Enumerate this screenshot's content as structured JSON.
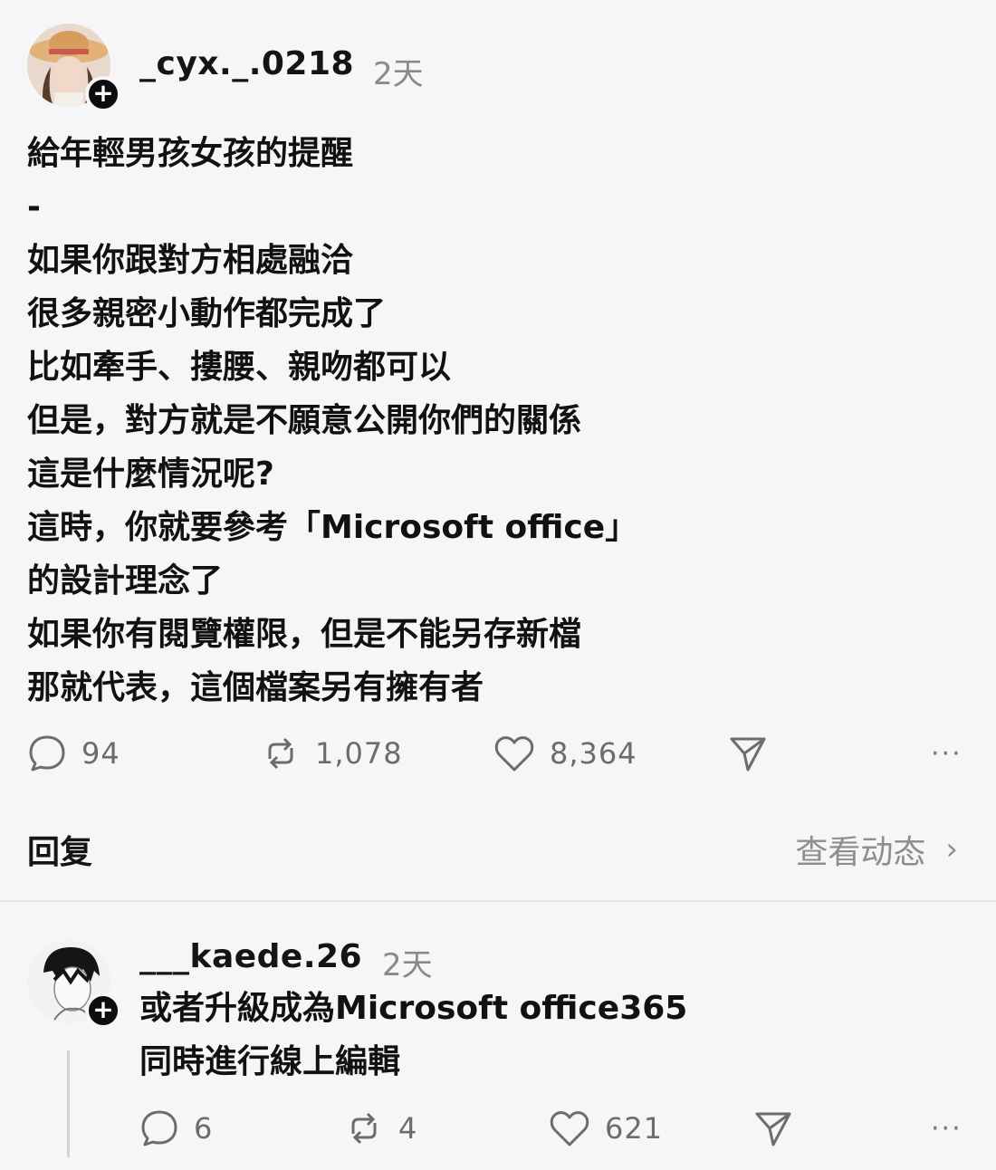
{
  "post": {
    "username": "_cyx._.0218",
    "time": "2天",
    "lines": [
      "給年輕男孩女孩的提醒",
      "-",
      "如果你跟對方相處融洽",
      "很多親密小動作都完成了",
      "比如牽手、摟腰、親吻都可以",
      "但是，對方就是不願意公開你們的關係",
      "這是什麼情況呢?",
      "這時，你就要參考「Microsoft office」",
      "的設計理念了",
      "如果你有閱覽權限，但是不能另存新檔",
      "那就代表，這個檔案另有擁有者"
    ],
    "comments": "94",
    "reposts": "1,078",
    "likes": "8,364"
  },
  "reply_bar": {
    "label": "回复",
    "view_activity": "查看动态"
  },
  "reply": {
    "username": "___kaede.26",
    "time": "2天",
    "lines": [
      "或者升級成為Microsoft office365",
      "同時進行線上編輯"
    ],
    "comments": "6",
    "reposts": "4",
    "likes": "621"
  },
  "icons": {
    "comment": "comment-icon",
    "repost": "repost-icon",
    "like": "heart-icon",
    "share": "send-icon",
    "more": "more-icon",
    "follow": "plus-icon",
    "chevron": "chevron-right-icon"
  }
}
